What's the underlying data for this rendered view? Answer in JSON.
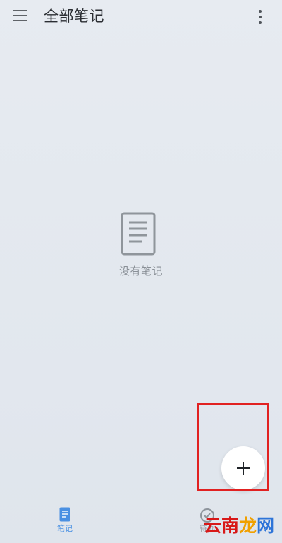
{
  "header": {
    "title": "全部笔记",
    "menu_icon": "menu-icon",
    "more_icon": "more-vertical-icon"
  },
  "empty_state": {
    "message": "没有笔记",
    "icon": "document-icon"
  },
  "fab": {
    "label": "+",
    "icon": "add-icon"
  },
  "highlight": {
    "color": "#e12121"
  },
  "bottom_nav": {
    "items": [
      {
        "label": "笔记",
        "icon": "notes-icon",
        "active": true,
        "color": "#4a90e2"
      },
      {
        "label": "待办",
        "icon": "todo-icon",
        "active": false,
        "color": "#9aa1a8"
      }
    ]
  },
  "watermark": {
    "parts": [
      "云",
      "南",
      "龙",
      "网"
    ]
  }
}
